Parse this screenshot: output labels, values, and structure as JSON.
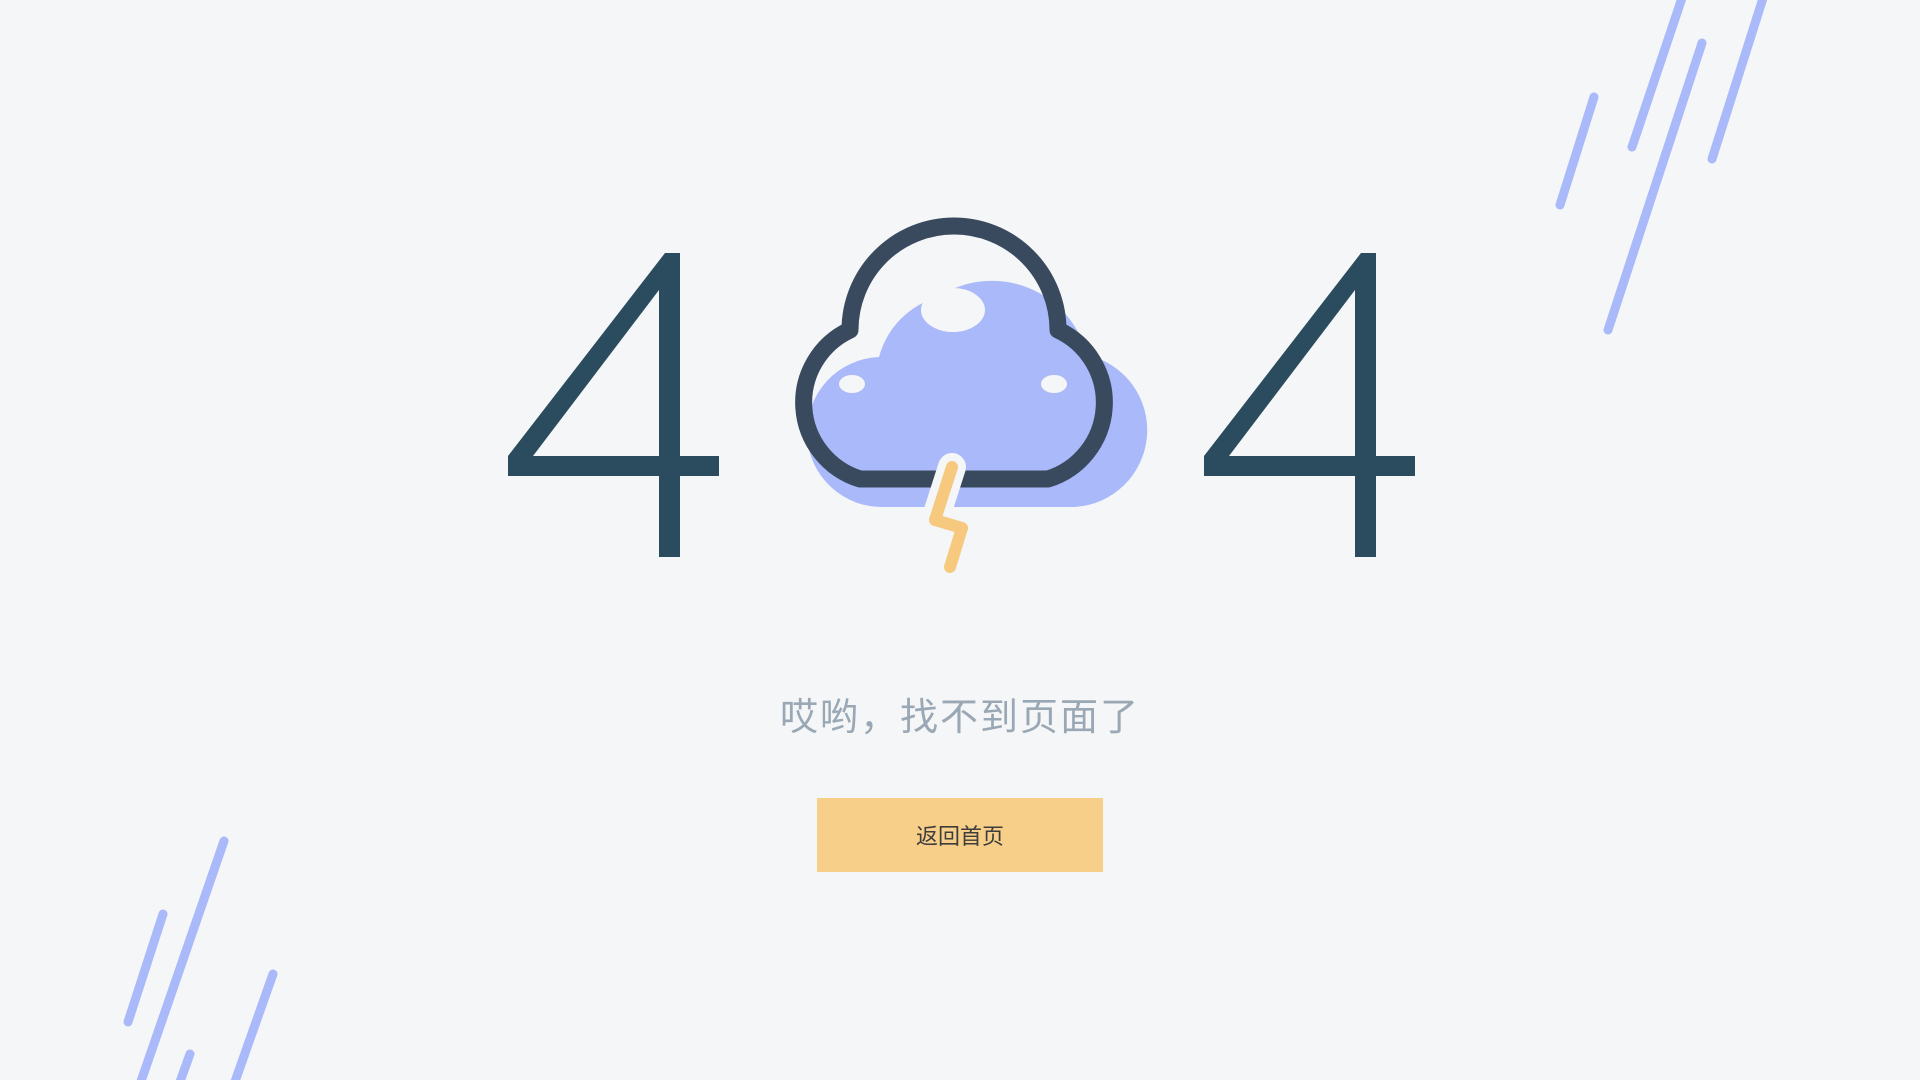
{
  "error": {
    "code_left_digit": "4",
    "code_right_digit": "4"
  },
  "message": "哎哟，找不到页面了",
  "home_button": {
    "label": "返回首页"
  },
  "colors": {
    "background": "#f5f6f7",
    "digit": "#2b4b5e",
    "cloud_fill": "#a9b9fa",
    "cloud_outline": "#394a5e",
    "lightning": "#f6c97f",
    "rain": "#a9b9fa",
    "message_text": "#9aa8b5",
    "button_bg": "#f7cf88",
    "button_text": "#3d3d3d"
  },
  "icons": {
    "cloud": "cloud-with-lightning-icon",
    "rain": "rain-streaks"
  }
}
